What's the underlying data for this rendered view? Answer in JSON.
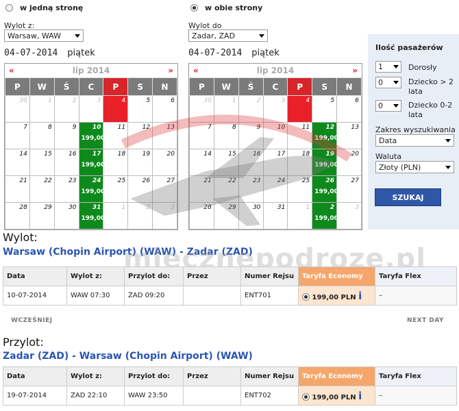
{
  "trip_type": {
    "one_way_label": "w jedną stronę",
    "round_trip_label": "w obie strony",
    "selected": "round_trip"
  },
  "departure": {
    "label": "Wylot z:",
    "value": "Warsaw, WAW",
    "date": "04-07-2014",
    "day": "piątek"
  },
  "arrival": {
    "label": "Wylot do",
    "value": "Zadar, ZAD",
    "date": "04-07-2014",
    "day": "piątek"
  },
  "calendar_common": {
    "prev": "«",
    "next": "»",
    "month": "lip 2014",
    "weekdays": [
      "P",
      "W",
      "Ś",
      "C",
      "P",
      "S",
      "N"
    ]
  },
  "calendar_left": {
    "rows": [
      [
        {
          "d": "30",
          "c": "dim"
        },
        {
          "d": "1",
          "c": "dim"
        },
        {
          "d": "2",
          "c": "dim"
        },
        {
          "d": "3",
          "c": "dim"
        },
        {
          "d": "4",
          "c": "today"
        },
        {
          "d": "5",
          "c": ""
        },
        {
          "d": "6",
          "c": ""
        }
      ],
      [
        {
          "d": "7",
          "c": ""
        },
        {
          "d": "8",
          "c": ""
        },
        {
          "d": "9",
          "c": ""
        },
        {
          "d": "10",
          "c": "avail",
          "p": "199,00"
        },
        {
          "d": "11",
          "c": ""
        },
        {
          "d": "12",
          "c": ""
        },
        {
          "d": "13",
          "c": ""
        }
      ],
      [
        {
          "d": "14",
          "c": ""
        },
        {
          "d": "15",
          "c": ""
        },
        {
          "d": "16",
          "c": ""
        },
        {
          "d": "17",
          "c": "avail",
          "p": "199,00"
        },
        {
          "d": "18",
          "c": ""
        },
        {
          "d": "19",
          "c": ""
        },
        {
          "d": "20",
          "c": ""
        }
      ],
      [
        {
          "d": "21",
          "c": ""
        },
        {
          "d": "22",
          "c": ""
        },
        {
          "d": "23",
          "c": ""
        },
        {
          "d": "24",
          "c": "avail",
          "p": "199,00"
        },
        {
          "d": "25",
          "c": ""
        },
        {
          "d": "26",
          "c": ""
        },
        {
          "d": "27",
          "c": ""
        }
      ],
      [
        {
          "d": "28",
          "c": ""
        },
        {
          "d": "29",
          "c": ""
        },
        {
          "d": "30",
          "c": ""
        },
        {
          "d": "31",
          "c": "avail",
          "p": "199,00"
        },
        {
          "d": "1",
          "c": "dim"
        },
        {
          "d": "2",
          "c": "dim"
        },
        {
          "d": "3",
          "c": "dim"
        }
      ]
    ]
  },
  "calendar_right": {
    "rows": [
      [
        {
          "d": "30",
          "c": "dim"
        },
        {
          "d": "1",
          "c": "dim"
        },
        {
          "d": "2",
          "c": "dim"
        },
        {
          "d": "3",
          "c": "dim"
        },
        {
          "d": "4",
          "c": "today"
        },
        {
          "d": "5",
          "c": ""
        },
        {
          "d": "6",
          "c": ""
        }
      ],
      [
        {
          "d": "7",
          "c": ""
        },
        {
          "d": "8",
          "c": ""
        },
        {
          "d": "9",
          "c": ""
        },
        {
          "d": "10",
          "c": ""
        },
        {
          "d": "11",
          "c": ""
        },
        {
          "d": "12",
          "c": "avail",
          "p": "199,00"
        },
        {
          "d": "13",
          "c": ""
        }
      ],
      [
        {
          "d": "14",
          "c": ""
        },
        {
          "d": "15",
          "c": ""
        },
        {
          "d": "16",
          "c": ""
        },
        {
          "d": "17",
          "c": ""
        },
        {
          "d": "18",
          "c": ""
        },
        {
          "d": "19",
          "c": "avail",
          "p": "199,00"
        },
        {
          "d": "20",
          "c": ""
        }
      ],
      [
        {
          "d": "21",
          "c": ""
        },
        {
          "d": "22",
          "c": ""
        },
        {
          "d": "23",
          "c": ""
        },
        {
          "d": "24",
          "c": ""
        },
        {
          "d": "25",
          "c": ""
        },
        {
          "d": "26",
          "c": "avail",
          "p": "199,00"
        },
        {
          "d": "27",
          "c": ""
        }
      ],
      [
        {
          "d": "28",
          "c": ""
        },
        {
          "d": "29",
          "c": ""
        },
        {
          "d": "30",
          "c": ""
        },
        {
          "d": "31",
          "c": ""
        },
        {
          "d": "1",
          "c": "dim"
        },
        {
          "d": "2",
          "c": "avail dim",
          "p": "199,00"
        },
        {
          "d": "3",
          "c": "dim"
        }
      ]
    ]
  },
  "passengers": {
    "title": "Ilość pasażerów",
    "adults_value": "1",
    "adults_label": "Dorosły",
    "child_value": "0",
    "child_label": "Dziecko > 2 lata",
    "infant_value": "0",
    "infant_label": "Dziecko 0-2 lata"
  },
  "search_range": {
    "label": "Zakres wyszukiwania",
    "value": "Data"
  },
  "currency": {
    "label": "Waluta",
    "value": "Złoty (PLN)"
  },
  "search_button": "SZUKAJ",
  "watermark": "mlecznepodroze.pl",
  "columns": [
    "Data",
    "Wylot z:",
    "Przylot do:",
    "Przez",
    "Numer Rejsu",
    "Taryfa Economy",
    "Taryfa Flex"
  ],
  "outbound": {
    "heading": "Wylot:",
    "route": "Warsaw (Chopin Airport) (WAW) - Zadar (ZAD)",
    "row": {
      "date": "10-07-2014",
      "dep": "WAW 07:30",
      "arr": "ZAD 09:20",
      "via": "",
      "flight": "ENT701",
      "eco": "199,00 PLN",
      "flex": "–"
    }
  },
  "nav": {
    "earlier": "WCZEŚNIEJ",
    "next": "NEXT DAY"
  },
  "inbound": {
    "heading": "Przylot:",
    "route": "Zadar (ZAD) - Warsaw (Chopin Airport) (WAW)",
    "row": {
      "date": "19-07-2014",
      "dep": "ZAD 22:10",
      "arr": "WAW 23:50",
      "via": "",
      "flight": "ENT702",
      "eco": "199,00 PLN",
      "flex": "–"
    }
  }
}
